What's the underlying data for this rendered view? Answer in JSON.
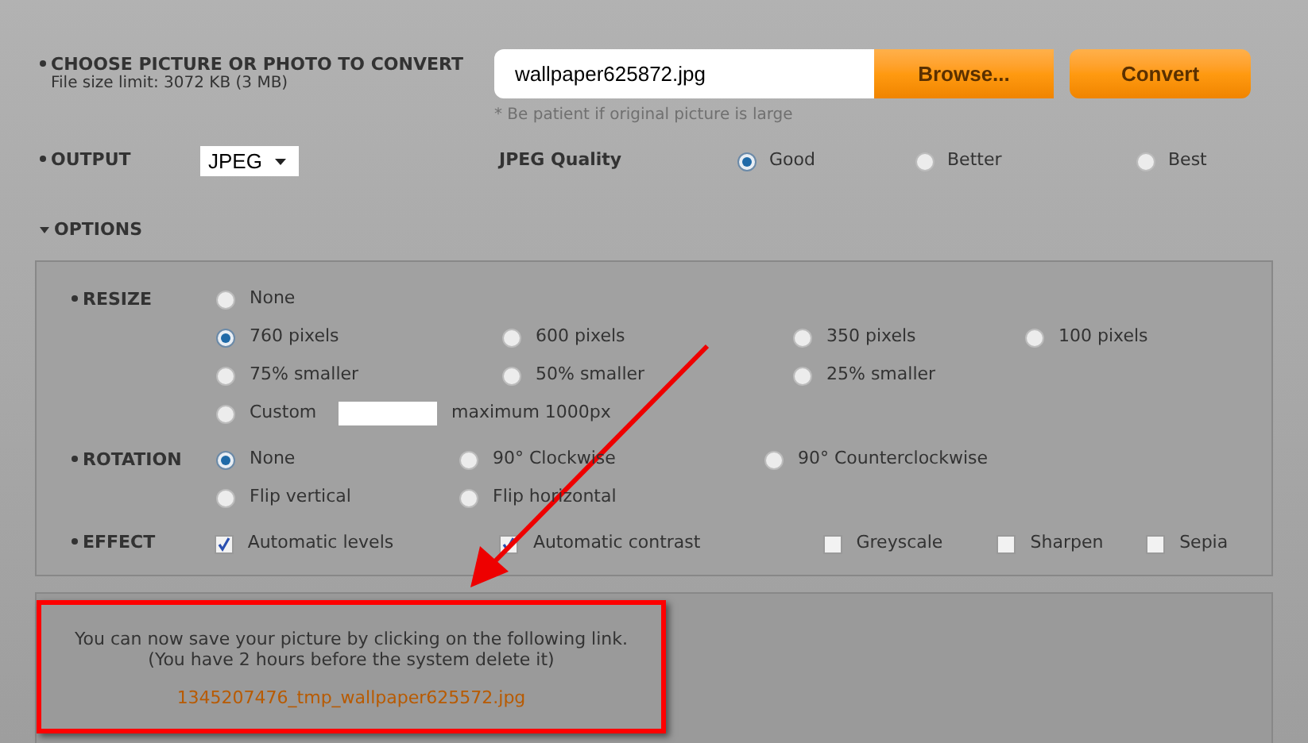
{
  "upload": {
    "label": "CHOOSE PICTURE OR PHOTO TO CONVERT",
    "sublabel": "File size limit: 3072 KB (3 MB)",
    "file_value": "wallpaper625872.jpg",
    "browse": "Browse...",
    "convert": "Convert",
    "hint": "* Be patient if original picture is large"
  },
  "output": {
    "label": "OUTPUT",
    "format": "JPEG",
    "quality_label": "JPEG Quality",
    "quality_options": [
      {
        "label": "Good",
        "selected": true
      },
      {
        "label": "Better",
        "selected": false
      },
      {
        "label": "Best",
        "selected": false
      }
    ]
  },
  "options": {
    "label": "OPTIONS",
    "expanded": true
  },
  "resize": {
    "label": "RESIZE",
    "rows": [
      [
        {
          "kind": "radio",
          "label": "None",
          "selected": false
        }
      ],
      [
        {
          "kind": "radio",
          "label": "760 pixels",
          "selected": true
        },
        {
          "kind": "radio",
          "label": "600 pixels",
          "selected": false
        },
        {
          "kind": "radio",
          "label": "350 pixels",
          "selected": false
        },
        {
          "kind": "radio",
          "label": "100 pixels",
          "selected": false
        }
      ],
      [
        {
          "kind": "radio",
          "label": "75% smaller",
          "selected": false
        },
        {
          "kind": "radio",
          "label": "50% smaller",
          "selected": false
        },
        {
          "kind": "radio",
          "label": "25% smaller",
          "selected": false
        }
      ],
      [
        {
          "kind": "custom",
          "label": "Custom",
          "selected": false,
          "suffix": "maximum 1000px"
        }
      ]
    ]
  },
  "rotation": {
    "label": "ROTATION",
    "rows": [
      [
        {
          "kind": "radio",
          "label": "None",
          "selected": true
        },
        {
          "kind": "radio",
          "label": "90° Clockwise",
          "selected": false
        },
        {
          "kind": "radio",
          "label": "90° Counterclockwise",
          "selected": false
        }
      ],
      [
        {
          "kind": "radio",
          "label": "Flip vertical",
          "selected": false
        },
        {
          "kind": "radio",
          "label": "Flip horizontal",
          "selected": false
        }
      ]
    ]
  },
  "effect": {
    "label": "EFFECT",
    "options": [
      {
        "label": "Automatic levels",
        "checked": true
      },
      {
        "label": "Automatic contrast",
        "checked": true
      },
      {
        "label": "Greyscale",
        "checked": false
      },
      {
        "label": "Sharpen",
        "checked": false
      },
      {
        "label": "Sepia",
        "checked": false
      }
    ]
  },
  "result": {
    "message_lines": [
      "You can now save your picture by clicking on the following link.",
      "(You have 2 hours before the system delete it)"
    ],
    "link": "1345207476_tmp_wallpaper625572.jpg"
  }
}
